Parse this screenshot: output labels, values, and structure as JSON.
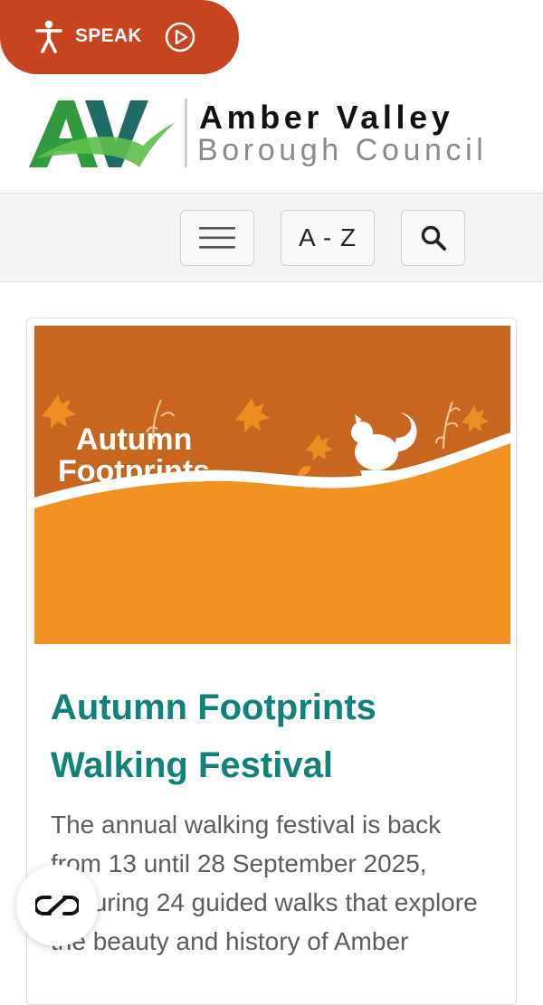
{
  "speak": {
    "label": "SPEAK"
  },
  "logo": {
    "line1": "Amber Valley",
    "line2": "Borough Council"
  },
  "toolbar": {
    "az_label": "A - Z"
  },
  "card": {
    "image_title_line1": "Autumn",
    "image_title_line2": "Footprints",
    "title": "Autumn Footprints Walking Festival",
    "text": "The annual walking festival is back from 13 until 28 September 2025, featuring 24 guided walks that explore the beauty and history of Amber"
  },
  "colors": {
    "speak_bg": "#c6441f",
    "title": "#0f827a",
    "banner_top": "#c8651f",
    "banner_bottom": "#f29222",
    "logo_green": "#2f9a3e",
    "logo_teal": "#1f6b67"
  },
  "icons": [
    "person-icon",
    "play-icon",
    "hamburger-icon",
    "search-icon",
    "cookie-settings-icon"
  ]
}
